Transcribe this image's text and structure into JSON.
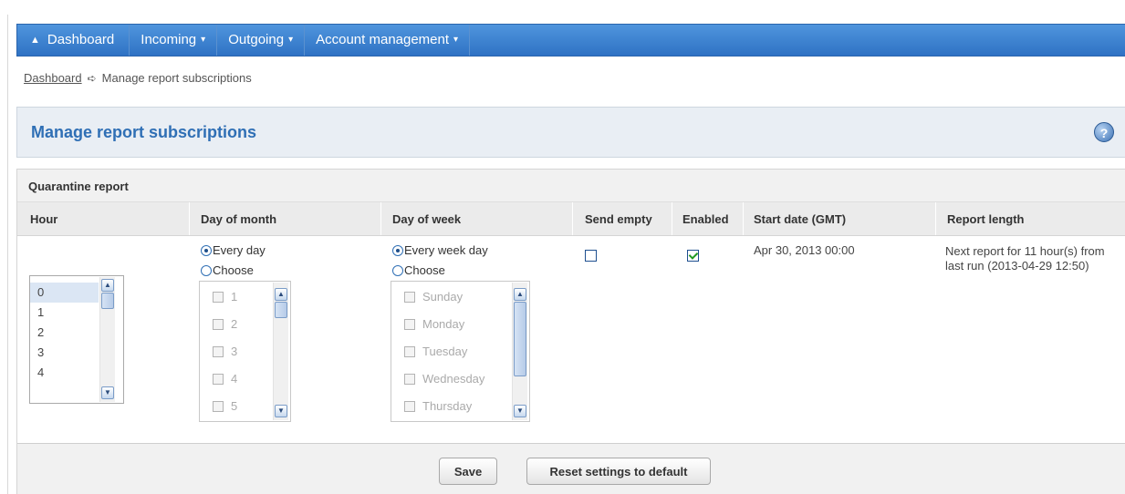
{
  "nav": {
    "dashboard": "Dashboard",
    "incoming": "Incoming",
    "outgoing": "Outgoing",
    "account": "Account management",
    "caret": "▾"
  },
  "breadcrumb": {
    "home": "Dashboard",
    "separator": "➪",
    "current": "Manage report subscriptions"
  },
  "page": {
    "title": "Manage report subscriptions",
    "help": "?"
  },
  "section": {
    "title": "Quarantine report"
  },
  "columns": [
    "Hour",
    "Day of month",
    "Day of week",
    "Send empty",
    "Enabled",
    "Start date (GMT)",
    "Report length"
  ],
  "hour_list": {
    "items": [
      "0",
      "1",
      "2",
      "3",
      "4"
    ],
    "selected": "0"
  },
  "day_of_month": {
    "every_label": "Every day",
    "choose_label": "Choose",
    "selected": "every",
    "items": [
      "1",
      "2",
      "3",
      "4",
      "5"
    ]
  },
  "day_of_week": {
    "every_label": "Every week day",
    "choose_label": "Choose",
    "selected": "every",
    "items": [
      "Sunday",
      "Monday",
      "Tuesday",
      "Wednesday",
      "Thursday"
    ]
  },
  "row": {
    "send_empty": false,
    "enabled": true,
    "start_date": "Apr 30, 2013 00:00",
    "report_length": "Next report for 11 hour(s) from last run (2013-04-29 12:50)"
  },
  "buttons": {
    "save": "Save",
    "reset": "Reset settings to default"
  },
  "colors": {
    "nav_bg": "#3a80cf",
    "title_text": "#2f6fb5",
    "panel_bg": "#e9eef4"
  }
}
